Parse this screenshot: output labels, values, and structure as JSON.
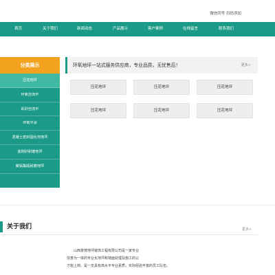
{
  "topbar": {
    "wechat_text": "微信同号 扫码添加"
  },
  "nav": {
    "items": [
      {
        "label": "首页"
      },
      {
        "label": "关于我们"
      },
      {
        "label": "新闻动态"
      },
      {
        "label": "产品展示"
      },
      {
        "label": "客户案例"
      },
      {
        "label": "在线留言"
      },
      {
        "label": "联系我们"
      }
    ]
  },
  "sidebar": {
    "title": "分类展示",
    "items": [
      {
        "label": "压花地坪"
      },
      {
        "label": "环氧自流平"
      },
      {
        "label": "彩砂自流平"
      },
      {
        "label": "环氧平涂"
      },
      {
        "label": "混凝土密封固化剂地坪"
      },
      {
        "label": "金刚砂耐磨地坪"
      },
      {
        "label": "聚氨酯超耐磨地坪"
      }
    ]
  },
  "banner": {
    "text": "环氧地坪一站式服务供应商，专业品质，无忧售后！",
    "more": "更多>"
  },
  "products": [
    {
      "label": "压花地坪"
    },
    {
      "label": "压花地坪"
    },
    {
      "label": "压花地坪"
    },
    {
      "label": "压花地坪"
    },
    {
      "label": "压花地坪"
    },
    {
      "label": "压花地坪"
    }
  ],
  "about": {
    "title": "关于我们",
    "more": "更多>",
    "lines": [
      "山西景榜地坪装饰工程有限公司是一家专业",
      "信誉为一体的专业化地坪和墙面处理及施工的公",
      "才能上岗，是一支具有高水平专业素质，实际经验丰富的员工队伍。"
    ]
  }
}
